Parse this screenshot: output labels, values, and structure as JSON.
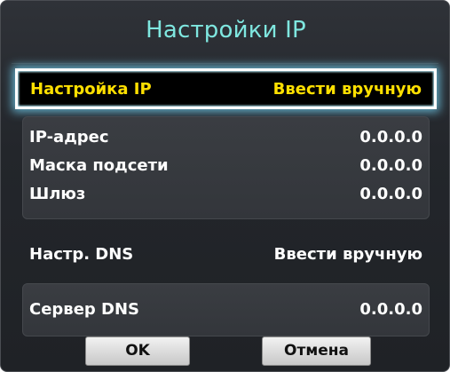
{
  "dialog": {
    "title": "Настройки IP",
    "ip_setting": {
      "label": "Настройка IP",
      "value": "Ввести вручную"
    },
    "ip_fields": [
      {
        "label": "IP-адрес",
        "value": "0.0.0.0"
      },
      {
        "label": "Маска подсети",
        "value": "0.0.0.0"
      },
      {
        "label": "Шлюз",
        "value": "0.0.0.0"
      }
    ],
    "dns_setting": {
      "label": "Настр. DNS",
      "value": "Ввести вручную"
    },
    "dns_server": {
      "label": "Сервер DNS",
      "value": "0.0.0.0"
    },
    "buttons": {
      "ok": "OK",
      "cancel": "Отмена"
    }
  },
  "colors": {
    "title": "#7fe7e0",
    "focused_text": "#ffe000",
    "focus_glow": "#78dcff",
    "text": "#ffffff"
  }
}
